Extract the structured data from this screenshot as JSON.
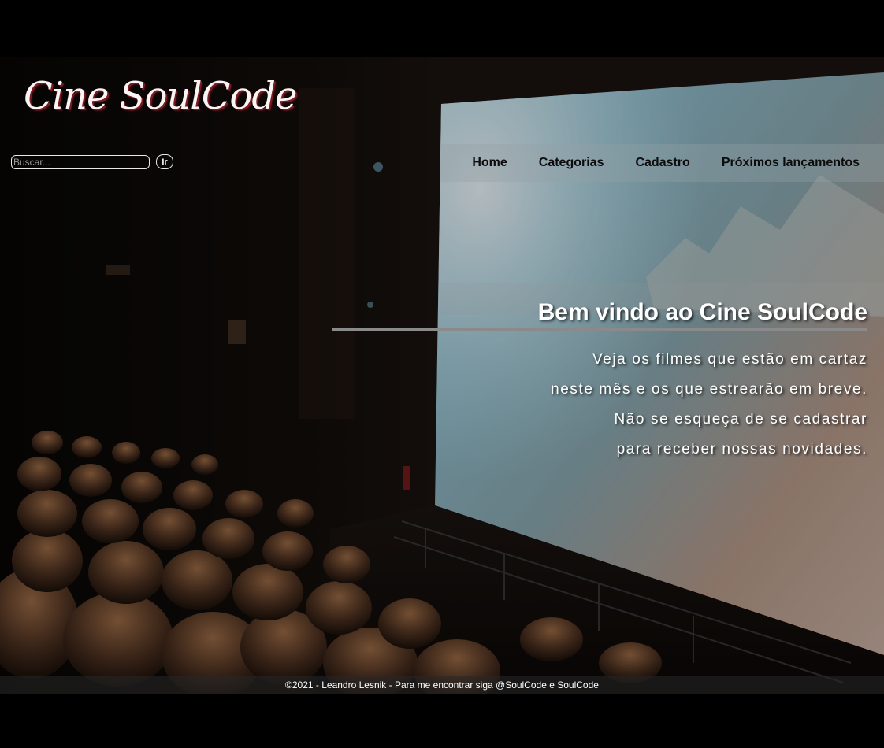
{
  "header": {
    "logo_text": "Cine SoulCode"
  },
  "search": {
    "placeholder": "Buscar...",
    "button_label": "Ir"
  },
  "nav": {
    "items": [
      {
        "label": "Home"
      },
      {
        "label": "Categorias"
      },
      {
        "label": "Cadastro"
      },
      {
        "label": "Próximos lançamentos"
      }
    ]
  },
  "hero": {
    "title": "Bem vindo ao Cine SoulCode",
    "lines": [
      "Veja os filmes que estão em cartaz",
      "neste mês e os que estrearão em breve.",
      "Não se esqueça de se cadastrar",
      "para receber nossas novidades."
    ]
  },
  "footer": {
    "text": "©2021 - Leandro Lesnik - Para me encontrar siga @SoulCode e SoulCode"
  }
}
